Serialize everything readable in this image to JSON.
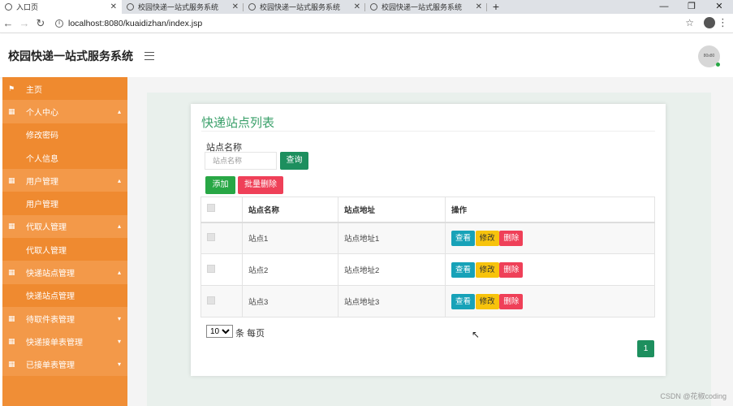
{
  "browser": {
    "tabs": [
      {
        "title": "入口页",
        "active": true
      },
      {
        "title": "校园快递一站式服务系统",
        "active": false
      },
      {
        "title": "校园快递一站式服务系统",
        "active": false
      },
      {
        "title": "校园快递一站式服务系统",
        "active": false
      }
    ],
    "url": "localhost:8080/kuaidizhan/index.jsp"
  },
  "header": {
    "title": "校园快递一站式服务系统",
    "avatar_text": "80x80"
  },
  "sidebar": {
    "items": [
      {
        "label": "主页",
        "type": "home",
        "icon": "flag-icon"
      },
      {
        "label": "个人中心",
        "type": "parent",
        "icon": "grid-icon",
        "expanded": true
      },
      {
        "label": "修改密码",
        "type": "child"
      },
      {
        "label": "个人信息",
        "type": "child"
      },
      {
        "label": "用户管理",
        "type": "parent",
        "icon": "grid-icon",
        "expanded": true
      },
      {
        "label": "用户管理",
        "type": "child"
      },
      {
        "label": "代取人管理",
        "type": "parent",
        "icon": "grid-icon",
        "expanded": true
      },
      {
        "label": "代取人管理",
        "type": "child"
      },
      {
        "label": "快递站点管理",
        "type": "parent",
        "icon": "grid-icon",
        "expanded": true
      },
      {
        "label": "快递站点管理",
        "type": "child"
      },
      {
        "label": "待取件表管理",
        "type": "parent",
        "icon": "grid-icon",
        "expanded": false
      },
      {
        "label": "快递接单表管理",
        "type": "parent",
        "icon": "grid-icon",
        "expanded": false
      },
      {
        "label": "已接单表管理",
        "type": "parent",
        "icon": "grid-icon",
        "expanded": false
      }
    ]
  },
  "main": {
    "card_title": "快递站点列表",
    "search": {
      "label": "站点名称",
      "placeholder": "站点名称",
      "query_label": "查询"
    },
    "add_label": "添加",
    "batch_delete_label": "批量删除",
    "table": {
      "headers": [
        "",
        "站点名称",
        "站点地址",
        "操作"
      ],
      "rows": [
        {
          "name": "站点1",
          "address": "站点地址1"
        },
        {
          "name": "站点2",
          "address": "站点地址2"
        },
        {
          "name": "站点3",
          "address": "站点地址3"
        }
      ],
      "actions": {
        "view": "查看",
        "edit": "修改",
        "delete": "删除"
      }
    },
    "pager": {
      "page_size": "10",
      "page_size_suffix": "条 每页",
      "current_page": "1"
    }
  },
  "colors": {
    "sidebar": "#f08e36",
    "primary_green": "#1d8f5e",
    "danger": "#ef4058",
    "info": "#17a2b8",
    "warning": "#f7c30c"
  },
  "watermark": "CSDN @花椒coding"
}
